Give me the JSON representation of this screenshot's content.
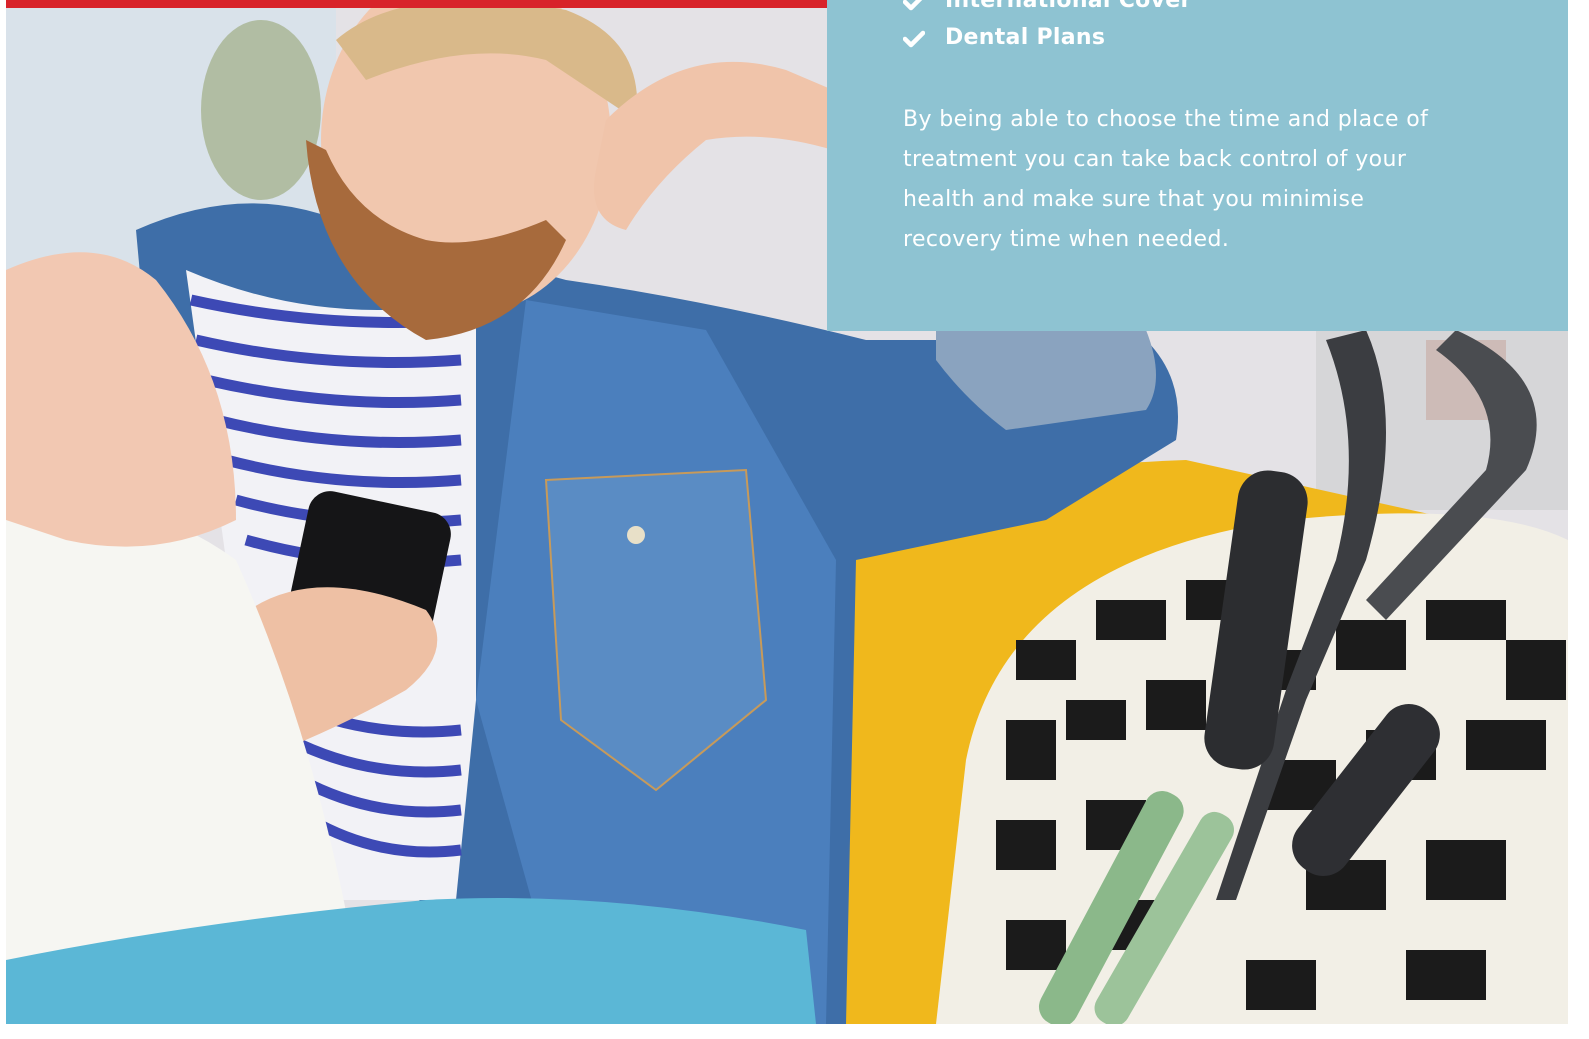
{
  "info_panel": {
    "features": [
      "International Cover",
      "Dental Plans"
    ],
    "description": "By being able to choose the time and place of treatment you can take back control of your health and make sure that you minimise recovery time when needed."
  },
  "colors": {
    "accent_bar": "#d8232a",
    "panel_background": "#8ec3d2",
    "panel_text": "#ffffff"
  },
  "icons": {
    "feature_bullet": "check-icon"
  }
}
